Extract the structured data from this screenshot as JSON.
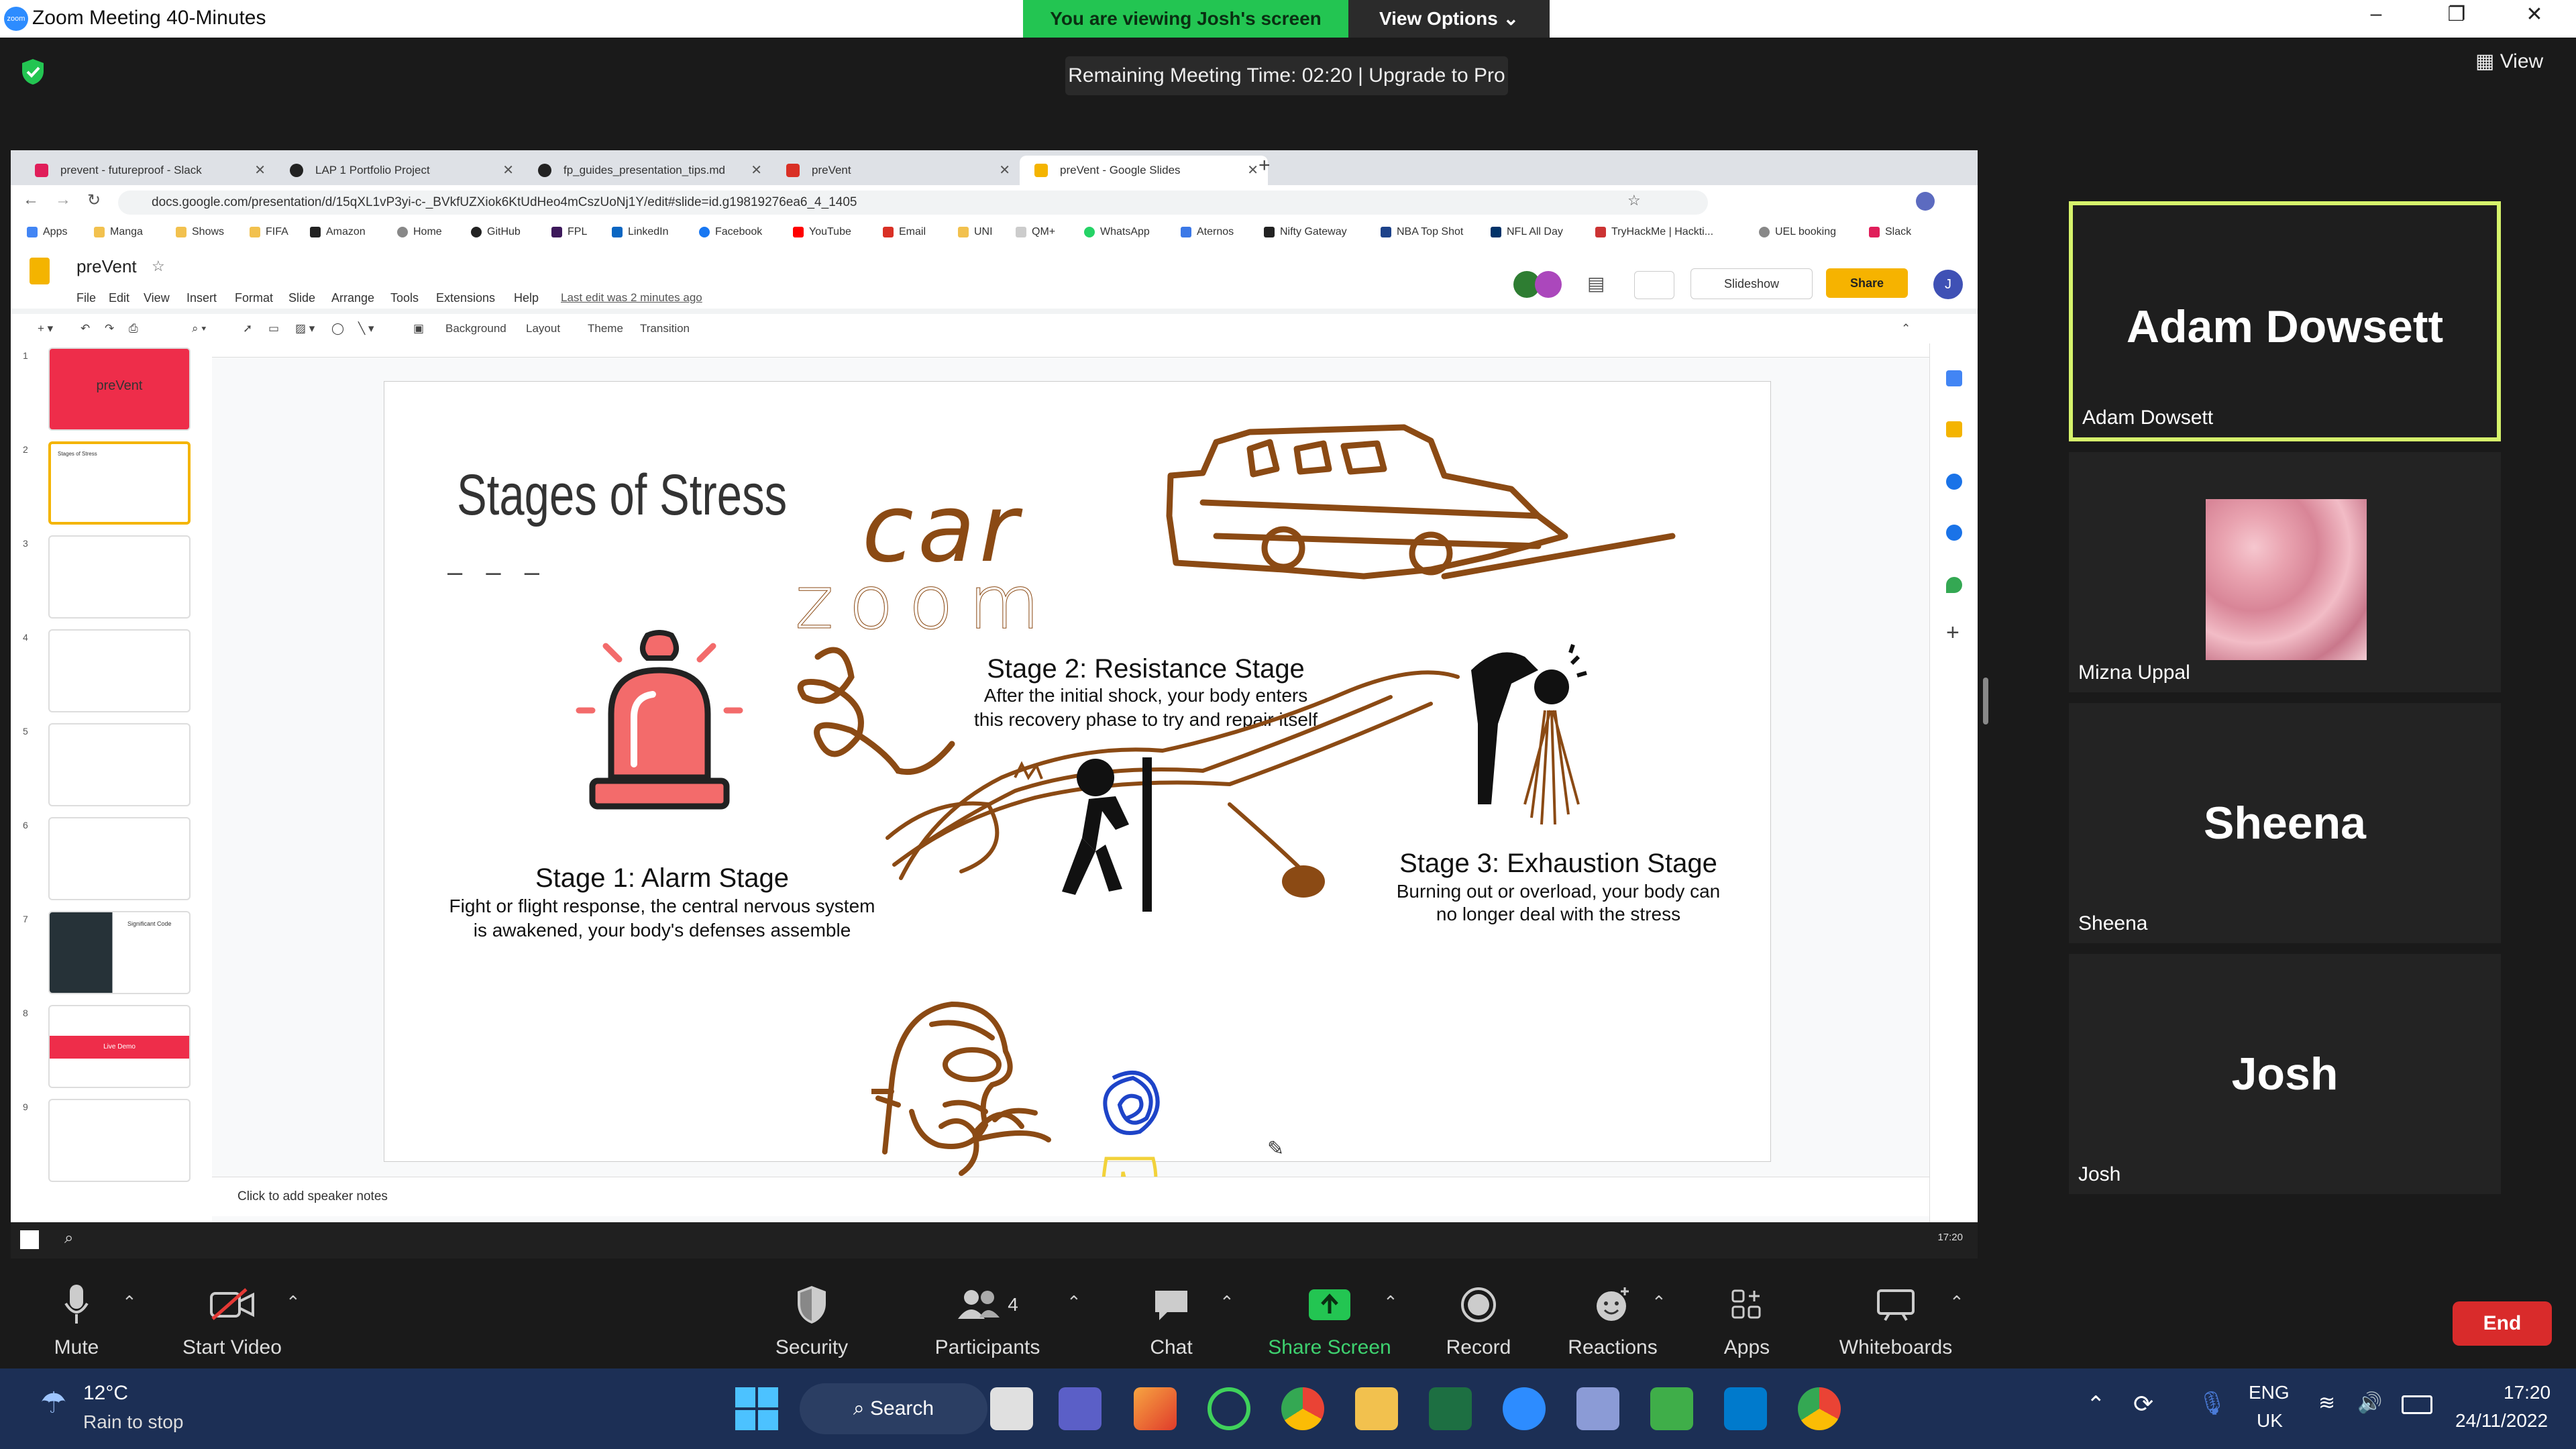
{
  "zoom": {
    "window_title": "Zoom Meeting 40-Minutes",
    "logo_text": "zoom",
    "viewing_banner": "You are viewing Josh's screen",
    "view_options": "View Options ⌄",
    "remaining_time": "Remaining Meeting Time: 02:20 | Upgrade to Pro",
    "view_button": "View",
    "colors": {
      "banner": "#23c552",
      "active_speaker": "#d6f36b",
      "end": "#d92b2b"
    }
  },
  "browser": {
    "tabs": [
      {
        "label": "prevent - futureproof - Slack",
        "icon": "slack-icon"
      },
      {
        "label": "LAP 1 Portfolio Project",
        "icon": "github-icon"
      },
      {
        "label": "fp_guides_presentation_tips.md",
        "icon": "github-icon"
      },
      {
        "label": "preVent",
        "icon": "mail-icon"
      },
      {
        "label": "preVent - Google Slides",
        "icon": "slides-icon"
      }
    ],
    "url": "docs.google.com/presentation/d/15qXL1vP3yi-c-_BVkfUZXiok6KtUdHeo4mCszUoNj1Y/edit#slide=id.g19819276ea6_4_1405",
    "bookmarks": [
      "Apps",
      "Manga",
      "Shows",
      "FIFA",
      "Amazon",
      "Home",
      "GitHub",
      "FPL",
      "LinkedIn",
      "Facebook",
      "YouTube",
      "Email",
      "UNI",
      "QM+",
      "WhatsApp",
      "Aternos",
      "Nifty Gateway",
      "NBA Top Shot",
      "NFL All Day",
      "TryHackMe | Hackti...",
      "UEL booking",
      "Slack"
    ]
  },
  "slides": {
    "doc_name": "preVent",
    "menu": [
      "File",
      "Edit",
      "View",
      "Insert",
      "Format",
      "Slide",
      "Arrange",
      "Tools",
      "Extensions",
      "Help"
    ],
    "last_edit": "Last edit was 2 minutes ago",
    "slideshow": "Slideshow",
    "share": "Share",
    "avatar_initial": "J",
    "toolbar": {
      "background": "Background",
      "layout": "Layout",
      "theme": "Theme",
      "transition": "Transition"
    },
    "thumb_numbers": [
      "1",
      "2",
      "3",
      "4",
      "5",
      "6",
      "7",
      "8",
      "9"
    ],
    "thumb_texts": {
      "t1": "preVent",
      "t2": "Stages of Stress",
      "t7": "Significant Code",
      "t8": "Live Demo"
    },
    "speaker_notes": "Click to add speaker notes",
    "taskbar_clock": "17:20"
  },
  "slide": {
    "title": "Stages of Stress",
    "dashes": "– – –",
    "stage1_title": "Stage 1: Alarm Stage",
    "stage1_desc_1": "Fight or flight response, the central nervous system",
    "stage1_desc_2": "is awakened, your body's defenses assemble",
    "stage2_title": "Stage 2: Resistance Stage",
    "stage2_desc_1": "After the initial shock, your body enters",
    "stage2_desc_2": "this recovery phase to try and repair itself",
    "stage3_title": "Stage 3: Exhaustion Stage",
    "stage3_desc_1": "Burning out or overload, your body can",
    "stage3_desc_2": "no longer deal with the stress",
    "drawn_car": "car",
    "drawn_zoom": "zoom"
  },
  "participants": [
    {
      "big": "Adam Dowsett",
      "name": "Adam Dowsett"
    },
    {
      "big": "",
      "name": "Mizna Uppal"
    },
    {
      "big": "Sheena",
      "name": "Sheena"
    },
    {
      "big": "Josh",
      "name": "Josh"
    }
  ],
  "controls": {
    "mute": "Mute",
    "start_video": "Start Video",
    "security": "Security",
    "participants": "Participants",
    "participants_count": "4",
    "chat": "Chat",
    "share_screen": "Share Screen",
    "record": "Record",
    "reactions": "Reactions",
    "apps": "Apps",
    "whiteboards": "Whiteboards",
    "end": "End"
  },
  "windows": {
    "temperature": "12°C",
    "weather": "Rain to stop",
    "search": "Search",
    "lang1": "ENG",
    "lang2": "UK",
    "time": "17:20",
    "date": "24/11/2022"
  }
}
